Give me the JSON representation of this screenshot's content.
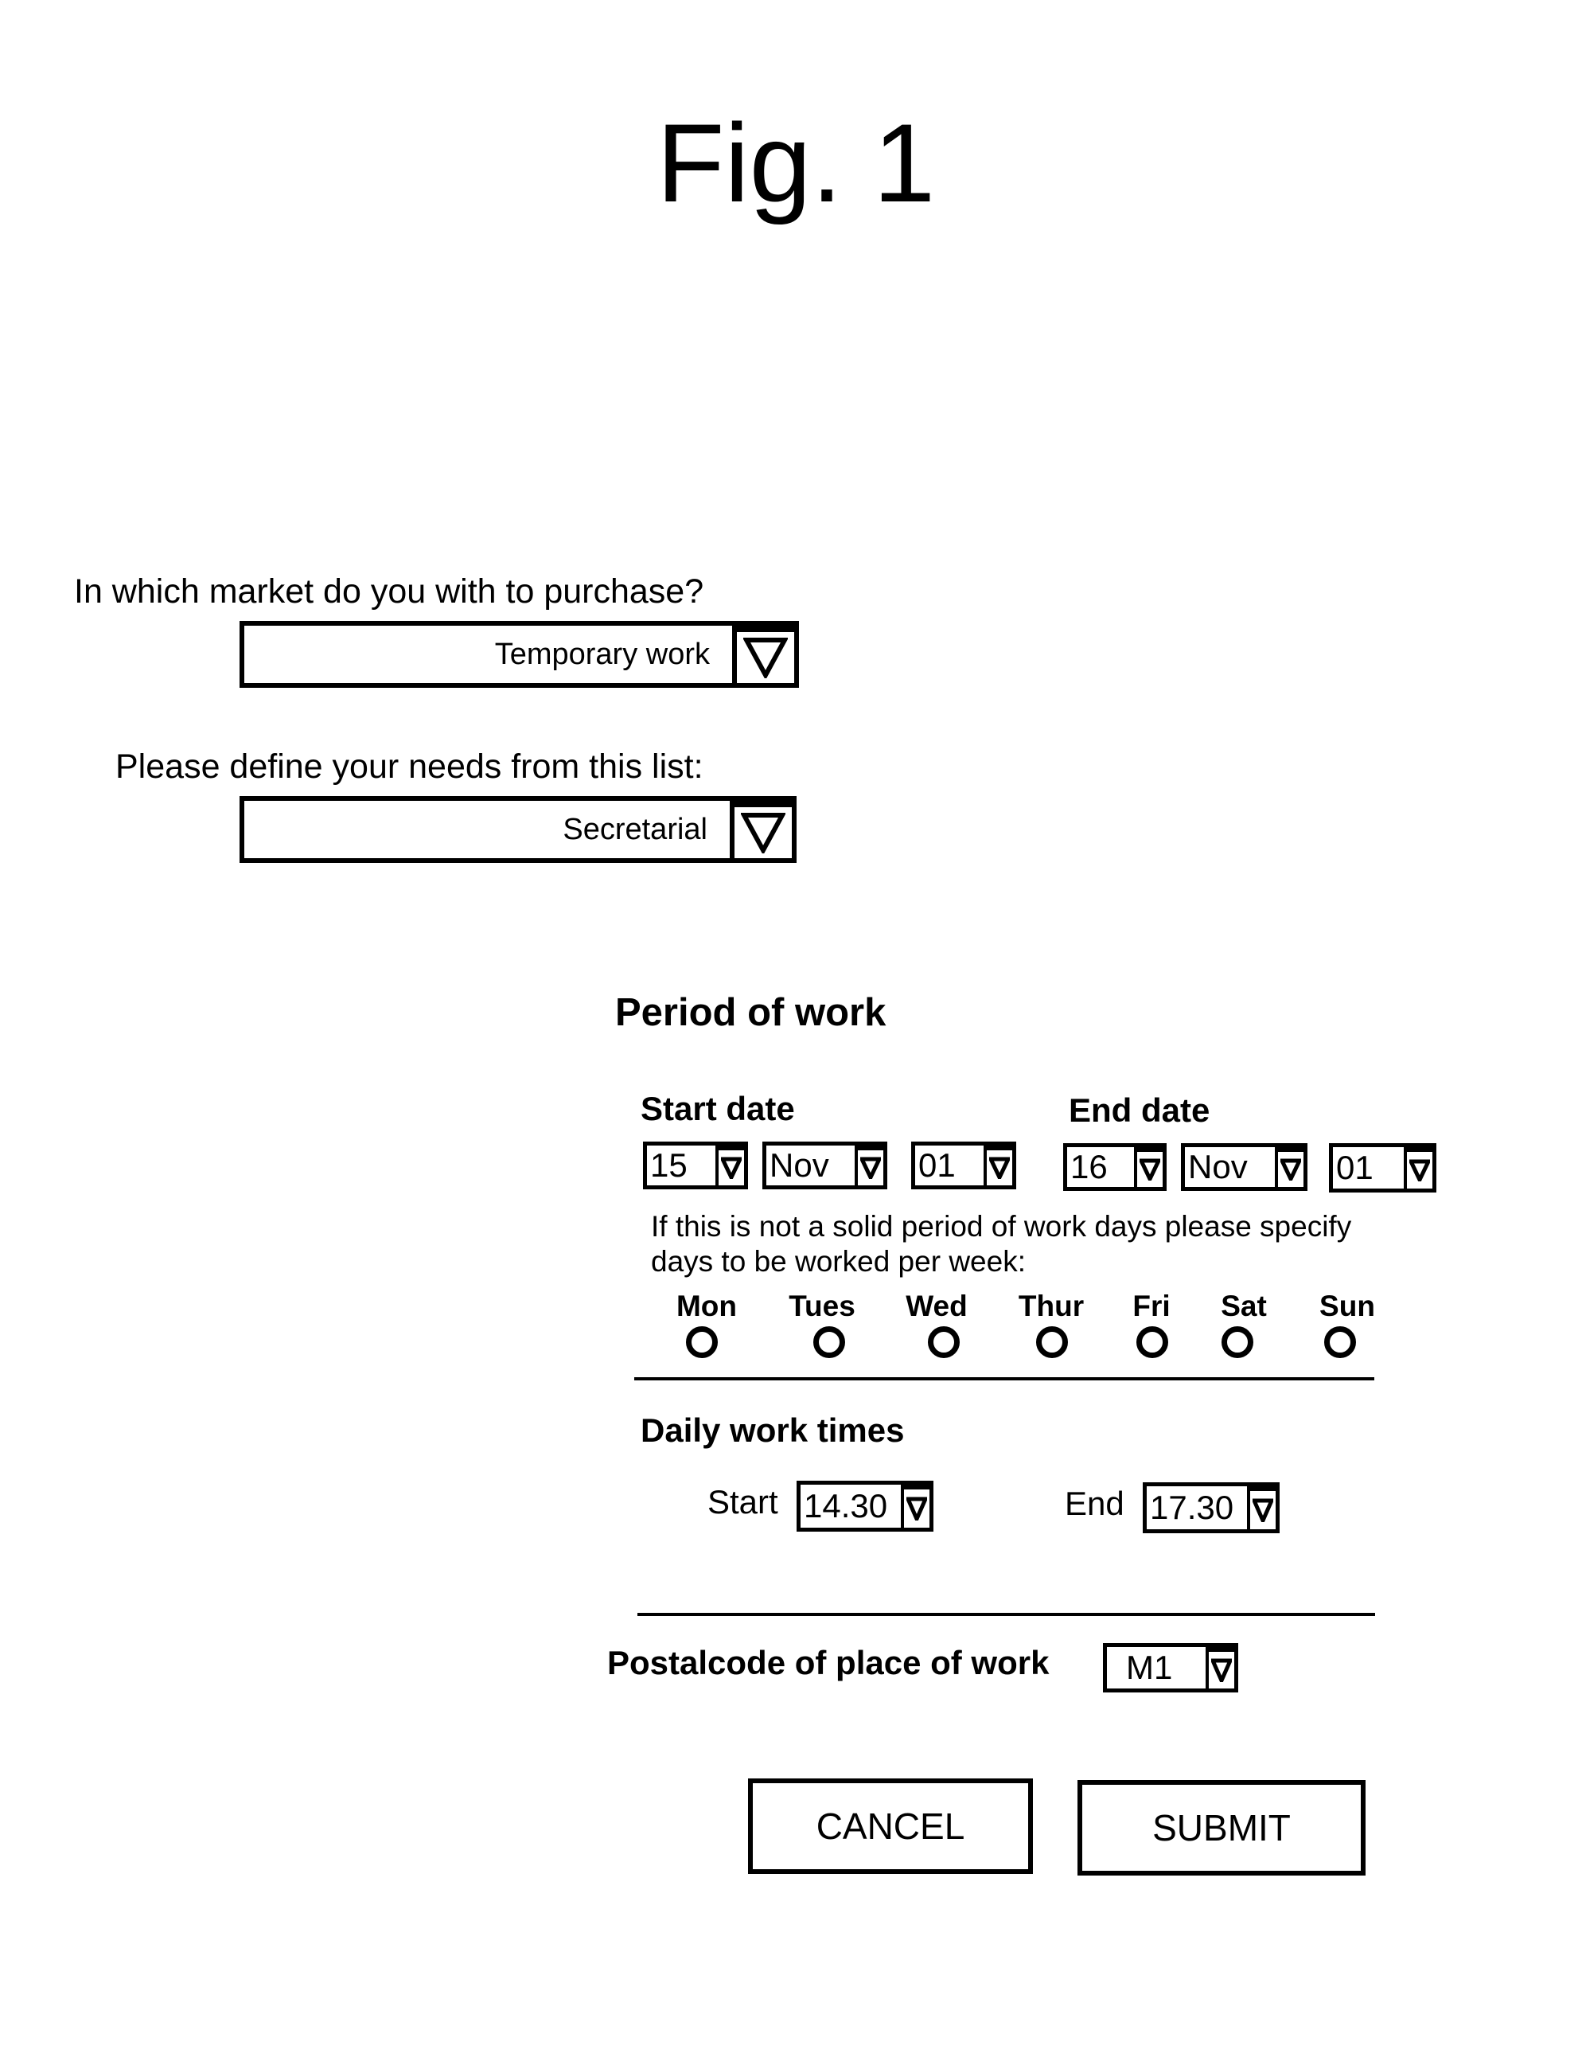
{
  "figure": {
    "title": "Fig. 1"
  },
  "market": {
    "question": "In which market do you with to purchase?",
    "value": "Temporary work",
    "icon": "triangle-down-icon"
  },
  "needs": {
    "question": "Please define your needs from this list:",
    "value": "Secretarial",
    "icon": "triangle-down-icon"
  },
  "period": {
    "heading": "Period of work",
    "start_label": "Start date",
    "end_label": "End date",
    "start": {
      "day": "15",
      "month": "Nov",
      "year": "01"
    },
    "end": {
      "day": "16",
      "month": "Nov",
      "year": "01"
    },
    "note_line1": "If this is not a solid period of work days please specify",
    "note_line2": "days to be worked per week:",
    "days": [
      "Mon",
      "Tues",
      "Wed",
      "Thur",
      "Fri",
      "Sat",
      "Sun"
    ]
  },
  "times": {
    "heading": "Daily work times",
    "start_label": "Start",
    "start_value": "14.30",
    "end_label": "End",
    "end_value": "17.30"
  },
  "postal": {
    "label": "Postalcode of place of work",
    "value": "M1"
  },
  "buttons": {
    "cancel": "CANCEL",
    "submit": "SUBMIT"
  }
}
